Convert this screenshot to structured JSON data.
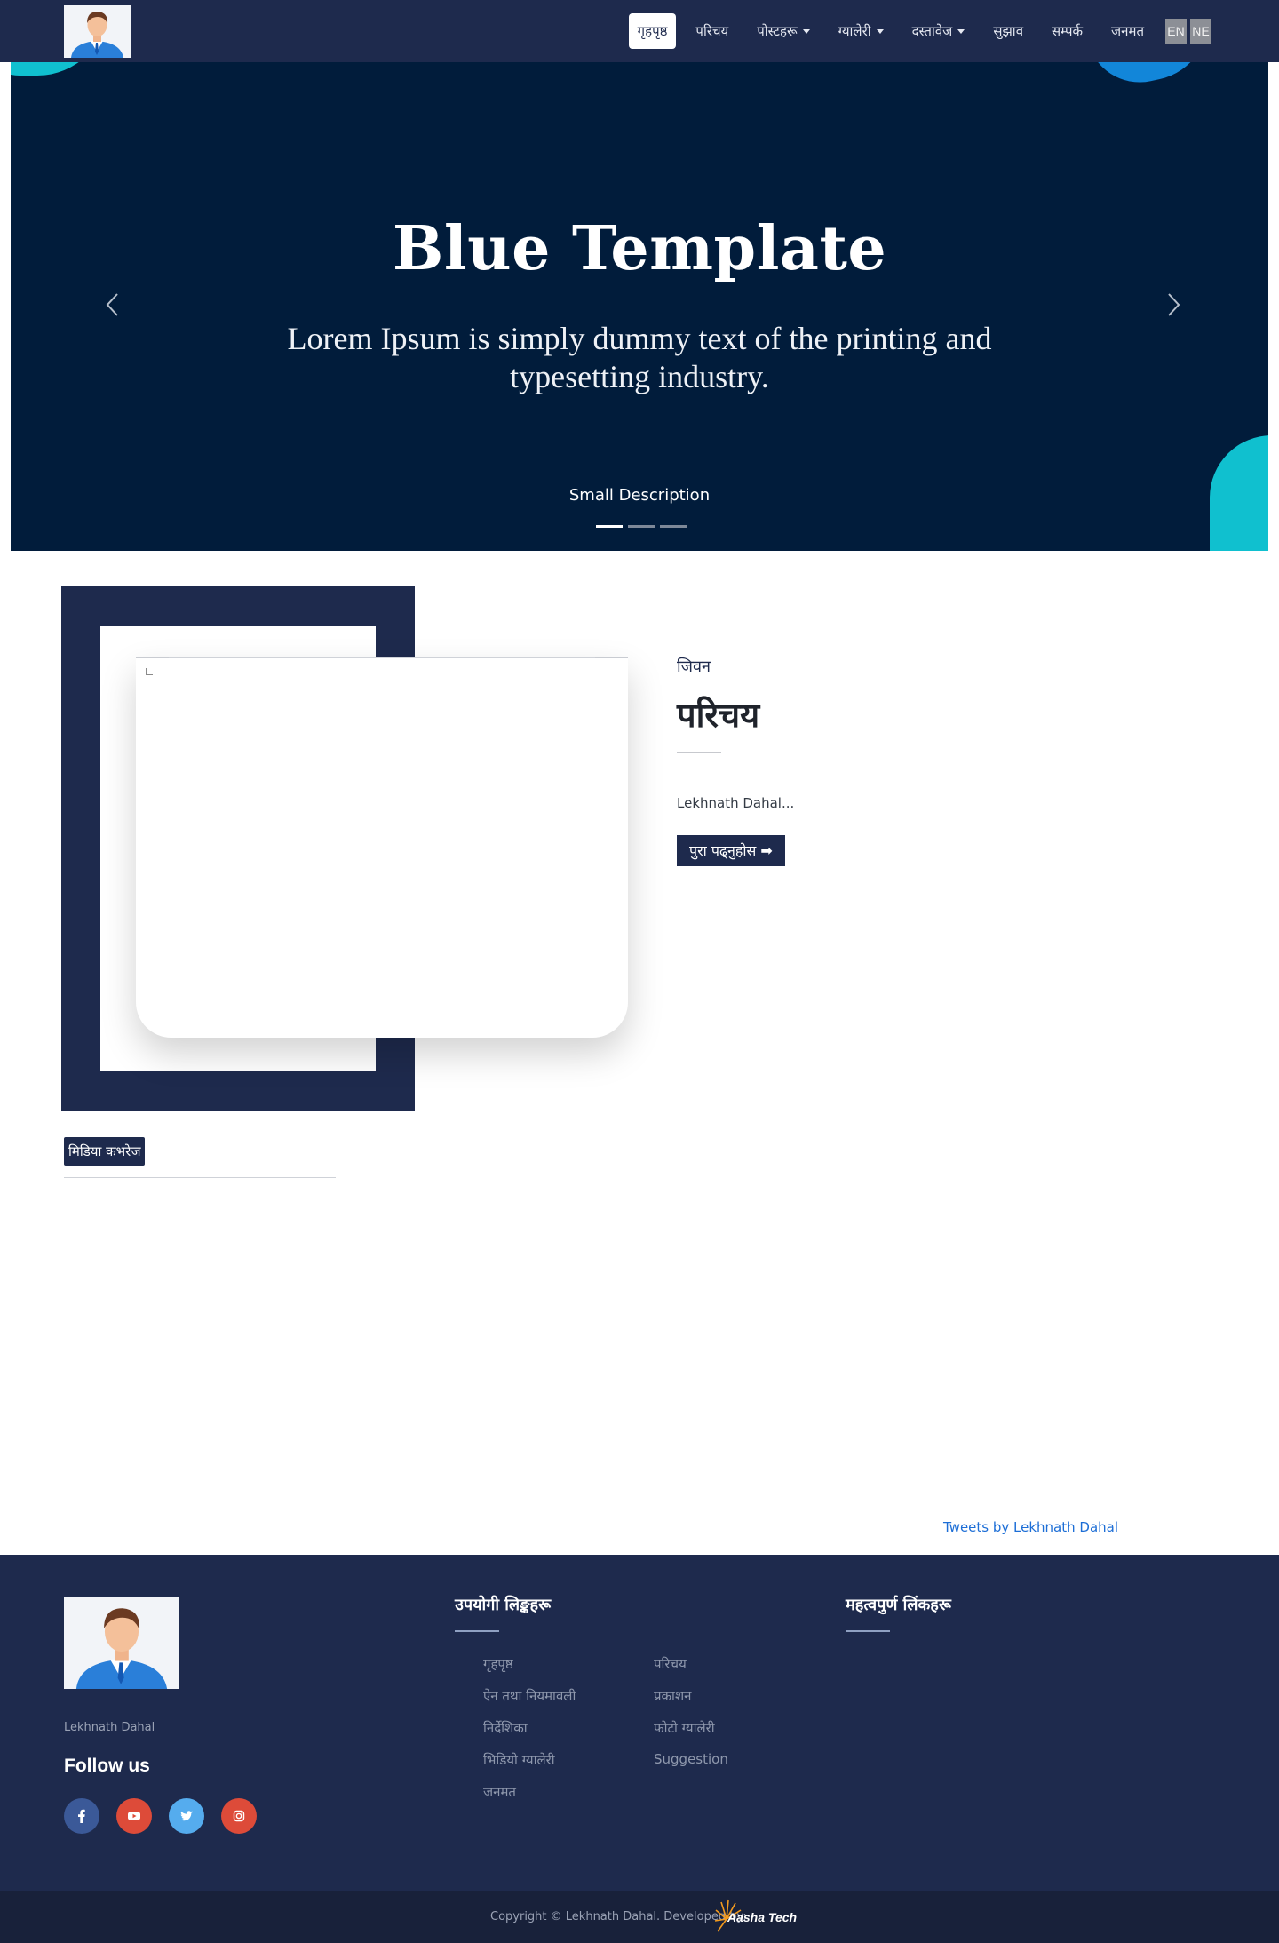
{
  "nav": {
    "logo_alt": "avatar-logo",
    "items": [
      {
        "label": "गृहपृष्ठ",
        "active": true,
        "dropdown": false
      },
      {
        "label": "परिचय",
        "active": false,
        "dropdown": false
      },
      {
        "label": "पोस्टहरू",
        "active": false,
        "dropdown": true
      },
      {
        "label": "ग्यालेरी",
        "active": false,
        "dropdown": true
      },
      {
        "label": "दस्तावेज",
        "active": false,
        "dropdown": true
      },
      {
        "label": "सुझाव",
        "active": false,
        "dropdown": false
      },
      {
        "label": "सम्पर्क",
        "active": false,
        "dropdown": false
      },
      {
        "label": "जनमत",
        "active": false,
        "dropdown": false
      }
    ],
    "lang_en": "EN",
    "lang_ne": "NE"
  },
  "hero": {
    "title": "Blue Template",
    "subtitle": "Lorem Ipsum is simply dummy text of the printing and typesetting industry.",
    "description": "Small Description",
    "slides_count": 3,
    "active_slide": 1,
    "colors": {
      "background": "#011c3b",
      "accent_teal": "#10c0cf",
      "accent_blue": "#1286d9"
    }
  },
  "about": {
    "eyebrow": "जिवन",
    "title": "परिचय",
    "text": "Lekhnath Dahal...",
    "read_more": "पुरा पढ्नुहोस ➡"
  },
  "media": {
    "tag": "मिडिया कभरेज"
  },
  "tweets": {
    "link": "Tweets by Lekhnath Dahal"
  },
  "footer": {
    "name": "Lekhnath Dahal",
    "follow": "Follow us",
    "socials": [
      {
        "icon": "facebook-icon",
        "color": "#3b5998"
      },
      {
        "icon": "youtube-icon",
        "color": "#dd4b39"
      },
      {
        "icon": "twitter-icon",
        "color": "#55acee"
      },
      {
        "icon": "instagram-icon",
        "color": "#dd4b39"
      }
    ],
    "useful_title": "उपयोगी लिङ्कहरू",
    "useful_links_col1": [
      "गृहपृष्ठ",
      "ऐन तथा नियमावली",
      "निर्देशिका",
      "भिडियो ग्यालेरी",
      "जनमत"
    ],
    "useful_links_col2": [
      "परिचय",
      "प्रकाशन",
      "फोटो ग्यालेरी",
      "Suggestion"
    ],
    "important_title": "महत्वपुर्ण लिंकहरू",
    "copyright": "Copyright © Lekhnath Dahal. Developed by:",
    "developer": "Aasha Tech",
    "colors": {
      "footer_bg": "#1e2a4d",
      "bottom_bg": "#18213a"
    }
  }
}
